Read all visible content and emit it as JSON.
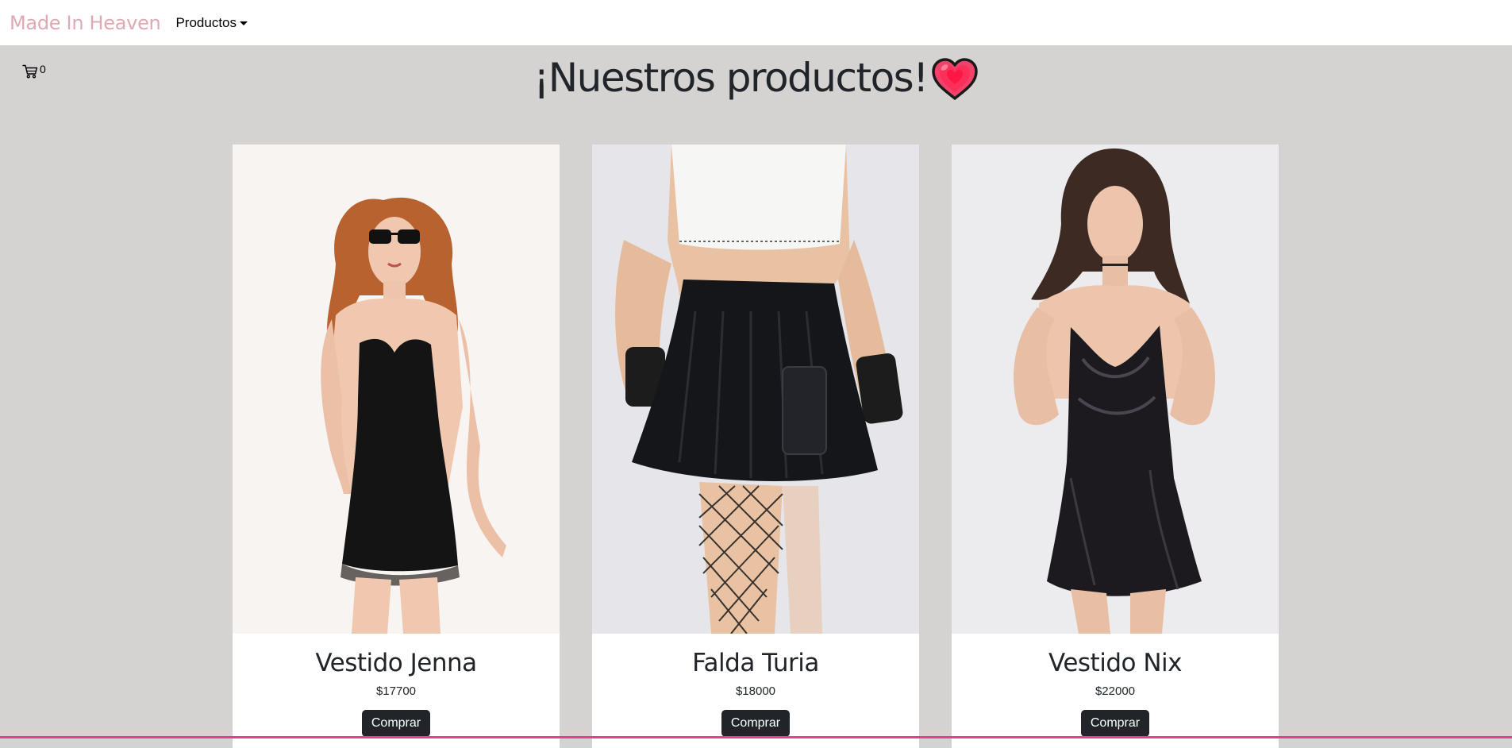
{
  "navbar": {
    "brand": "Made In Heaven",
    "products_dropdown": "Productos"
  },
  "cart": {
    "icon": "cart-icon",
    "count": "0"
  },
  "page_title": "¡Nuestros productos!",
  "products": [
    {
      "name": "Vestido Jenna",
      "price": "$17700",
      "button": "Comprar",
      "image": "model-black-slip-dress"
    },
    {
      "name": "Falda Turia",
      "price": "$18000",
      "button": "Comprar",
      "image": "black-pleated-skirt"
    },
    {
      "name": "Vestido Nix",
      "price": "$22000",
      "button": "Comprar",
      "image": "black-satin-cowl-dress"
    }
  ],
  "colors": {
    "brand": "#e0a8b2",
    "background": "#d5d2d2",
    "button": "#212529",
    "accent_line": "#e83e8c"
  }
}
